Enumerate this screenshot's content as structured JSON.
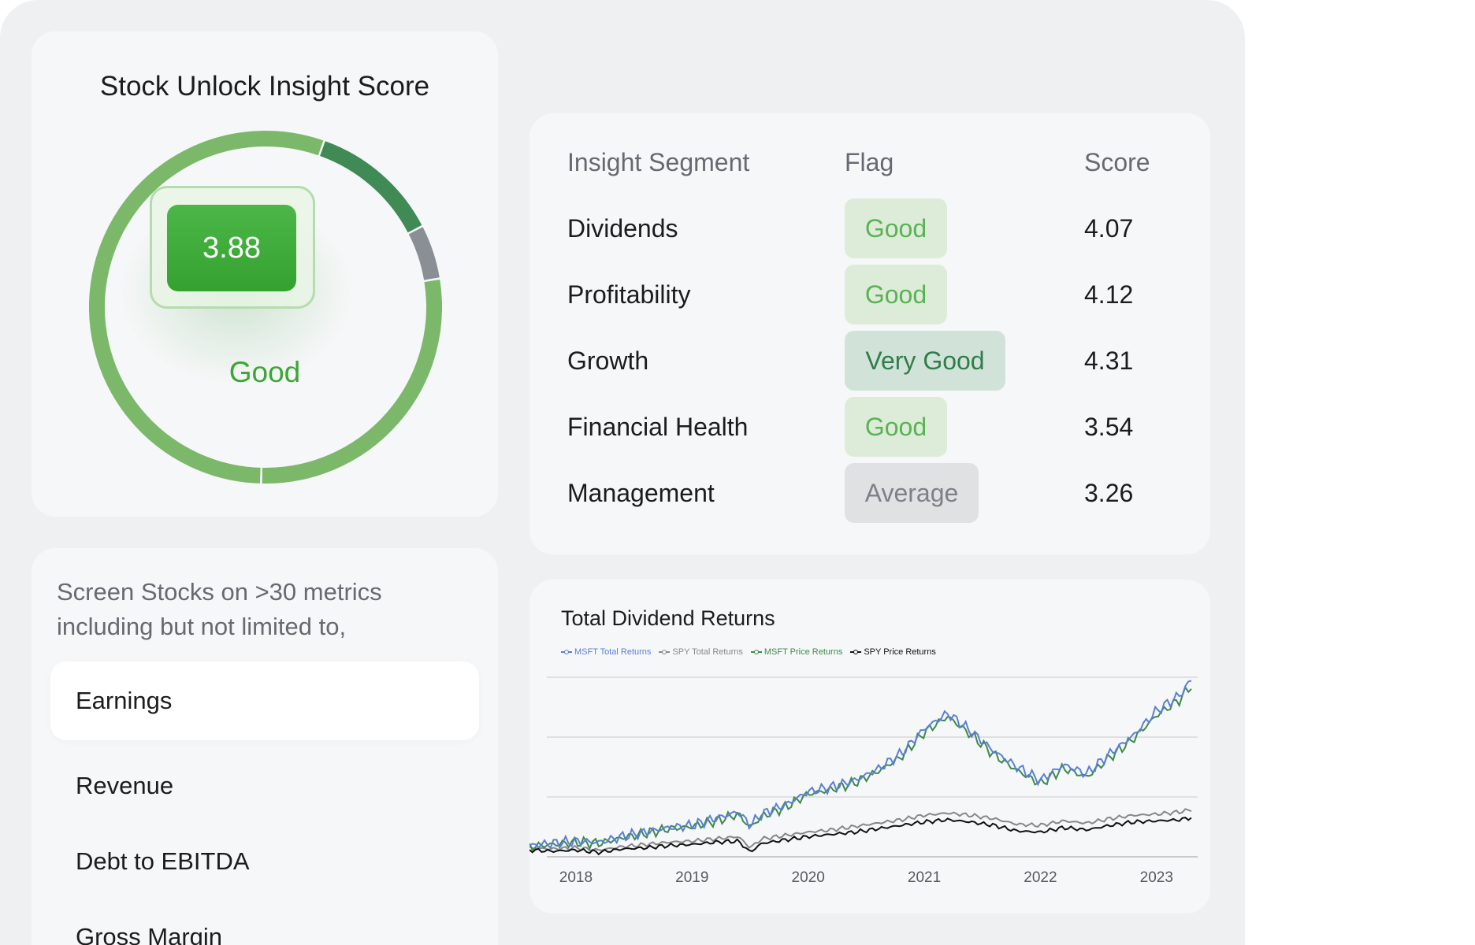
{
  "insight_score": {
    "title": "Stock Unlock Insight Score",
    "value": "3.88",
    "label": "Good",
    "gauge_segments": [
      {
        "fraction": 0.55,
        "color": "#7cb86a"
      },
      {
        "fraction": 0.12,
        "color": "#3f8a55"
      },
      {
        "fraction": 0.05,
        "color": "#8a8f96"
      },
      {
        "fraction": 0.28,
        "color": "#7cb86a"
      }
    ]
  },
  "segments_table": {
    "headers": {
      "segment": "Insight Segment",
      "flag": "Flag",
      "score": "Score"
    },
    "rows": [
      {
        "segment": "Dividends",
        "flag": "Good",
        "flag_type": "good",
        "score": "4.07"
      },
      {
        "segment": "Profitability",
        "flag": "Good",
        "flag_type": "good",
        "score": "4.12"
      },
      {
        "segment": "Growth",
        "flag": "Very Good",
        "flag_type": "vgood",
        "score": "4.31"
      },
      {
        "segment": "Financial Health",
        "flag": "Good",
        "flag_type": "good",
        "score": "3.54"
      },
      {
        "segment": "Management",
        "flag": "Average",
        "flag_type": "avg",
        "score": "3.26"
      }
    ]
  },
  "metrics": {
    "intro": "Screen Stocks on >30 metrics including but not limited to,",
    "items": [
      "Earnings",
      "Revenue",
      "Debt to EBITDA",
      "Gross Margin"
    ],
    "selected": "Earnings"
  },
  "chart_data": {
    "type": "line",
    "title": "Total Dividend Returns",
    "x_ticks": [
      "2018",
      "2019",
      "2020",
      "2021",
      "2022",
      "2023"
    ],
    "x": [
      2017.6,
      2017.8,
      2018.0,
      2018.2,
      2018.4,
      2018.6,
      2018.8,
      2019.0,
      2019.2,
      2019.4,
      2019.5,
      2019.6,
      2019.8,
      2020.0,
      2020.2,
      2020.4,
      2020.6,
      2020.8,
      2021.0,
      2021.2,
      2021.4,
      2021.6,
      2021.8,
      2022.0,
      2022.2,
      2022.4,
      2022.6,
      2022.8,
      2023.0,
      2023.2,
      2023.3
    ],
    "series": [
      {
        "name": "MSFT Total Returns",
        "color": "#5b7fd6",
        "values": [
          0,
          2,
          4,
          3,
          8,
          12,
          16,
          18,
          24,
          30,
          18,
          28,
          36,
          48,
          52,
          58,
          68,
          82,
          104,
          118,
          102,
          84,
          70,
          58,
          72,
          64,
          82,
          98,
          120,
          134,
          148
        ]
      },
      {
        "name": "SPY Total Returns",
        "color": "#888888",
        "values": [
          -2,
          -3,
          -2,
          -4,
          -1,
          1,
          3,
          4,
          6,
          8,
          -2,
          6,
          9,
          12,
          14,
          17,
          20,
          23,
          27,
          29,
          27,
          24,
          19,
          18,
          22,
          20,
          24,
          27,
          28,
          30,
          32
        ]
      },
      {
        "name": "MSFT Price Returns",
        "color": "#3d8a4a",
        "values": [
          -1,
          1,
          3,
          2,
          7,
          11,
          15,
          17,
          22,
          28,
          16,
          26,
          34,
          46,
          50,
          56,
          66,
          79,
          101,
          115,
          99,
          81,
          67,
          55,
          69,
          61,
          79,
          95,
          116,
          130,
          143
        ]
      },
      {
        "name": "SPY Price Returns",
        "color": "#111111",
        "values": [
          -4,
          -5,
          -4,
          -6,
          -3,
          -2,
          0,
          1,
          3,
          4,
          -6,
          2,
          5,
          8,
          10,
          12,
          15,
          18,
          21,
          23,
          21,
          18,
          13,
          12,
          16,
          14,
          18,
          21,
          22,
          23,
          25
        ]
      }
    ],
    "xlim": [
      2017.6,
      2023.3
    ],
    "ylim": [
      -10,
      150
    ],
    "grid": true,
    "legend_position": "top-left"
  }
}
